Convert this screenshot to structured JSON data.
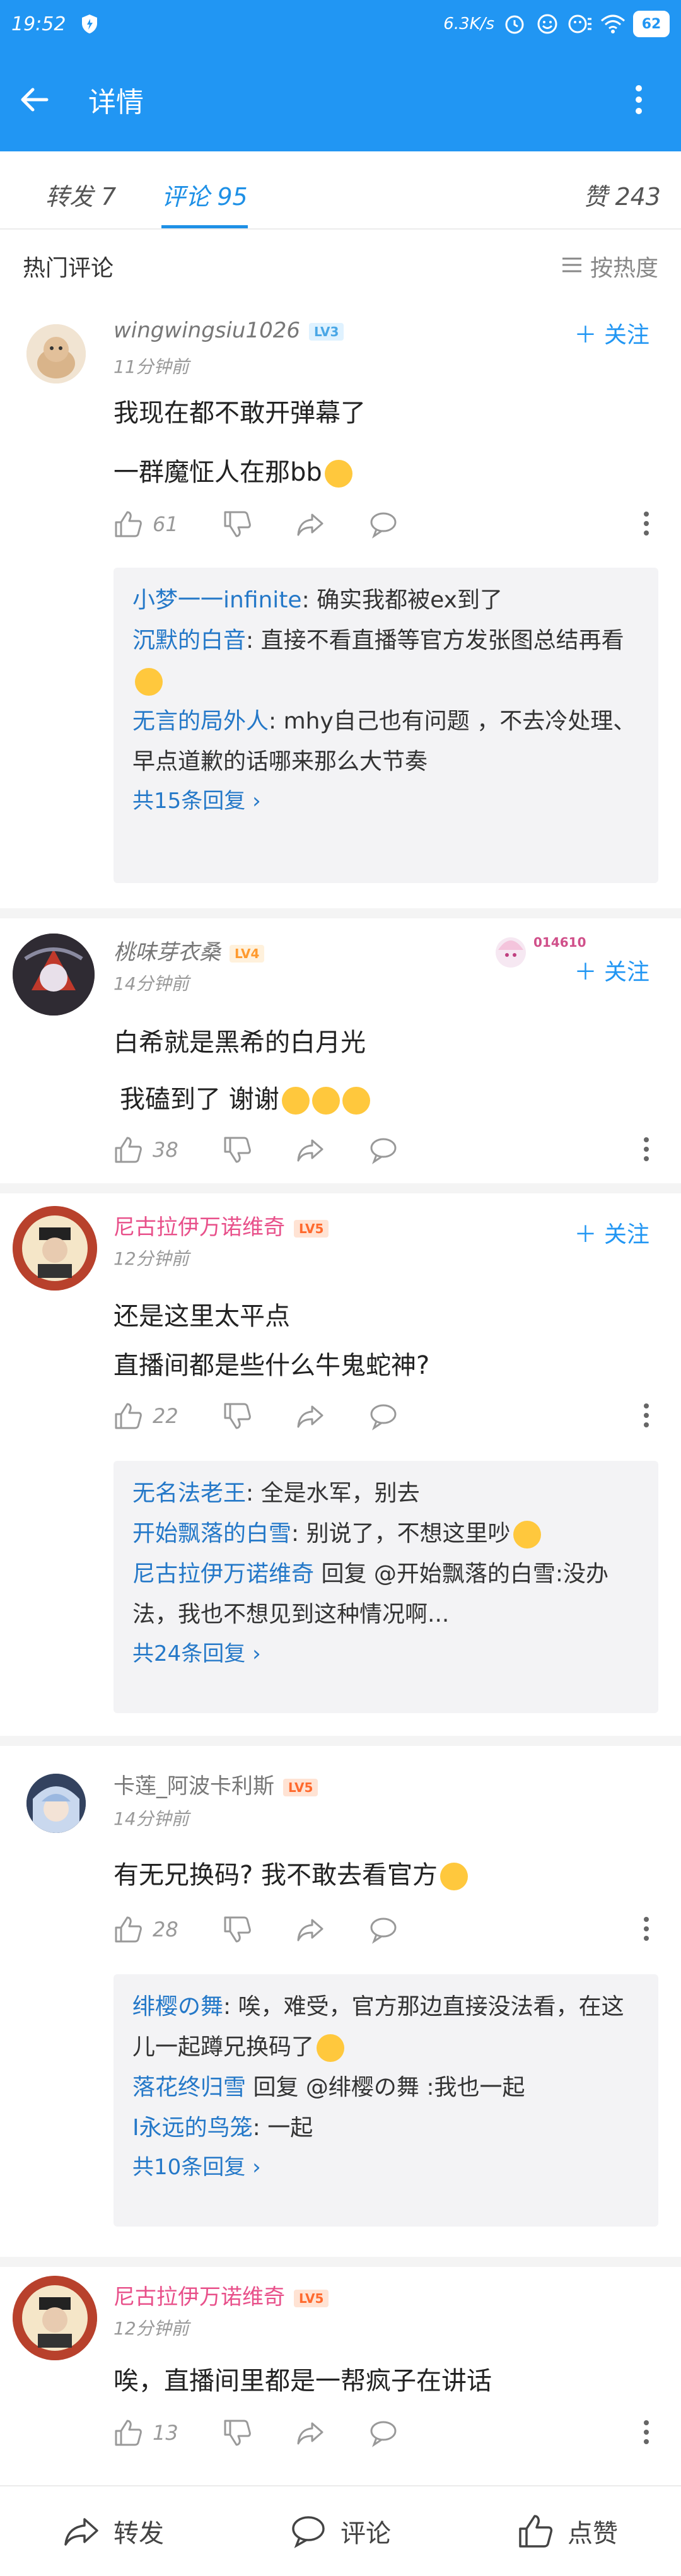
{
  "status_bar": {
    "time": "19:52",
    "network_speed": "6.3K/s",
    "battery": "62"
  },
  "app_bar": {
    "title": "详情"
  },
  "tabs": {
    "repost": "转发 7",
    "comments": "评论 95",
    "likes": "赞 243"
  },
  "section": {
    "hot_label": "热门评论",
    "sort_label": "按热度"
  },
  "comments": [
    {
      "user": "wingwingsiu1026",
      "level": "LV3",
      "time": "11分钟前",
      "lines": [
        "我现在都不敢开弹幕了",
        "一群魔怔人在那bb"
      ],
      "likes": "61",
      "follow": "关注",
      "replies": [
        {
          "name": "小梦一一infinite",
          "text": ": 确实我都被ex到了"
        },
        {
          "name": "沉默的白音",
          "text": ": 直接不看直播等官方发张图总结再看"
        },
        {
          "name": "无言的局外人",
          "text": ": mhy自己也有问题 ，不去冷处理、早点道歉的话哪来那么大节奏"
        }
      ],
      "more_replies": "共15条回复"
    },
    {
      "user": "桃味芽衣桑",
      "level": "LV4",
      "time": "14分钟前",
      "lines": [
        "白希就是黑希的白月光",
        "我磕到了 谢谢"
      ],
      "likes": "38",
      "follow": "关注",
      "badge": "014610"
    },
    {
      "user": "尼古拉伊万诺维奇",
      "level": "LV5",
      "time": "12分钟前",
      "lines": [
        "还是这里太平点",
        "直播间都是些什么牛鬼蛇神?"
      ],
      "likes": "22",
      "follow": "关注",
      "replies": [
        {
          "name": "无名法老王",
          "text": ": 全是水军，别去"
        },
        {
          "name": "开始飘落的白雪",
          "text": ": 别说了，不想这里吵"
        },
        {
          "name": "尼古拉伊万诺维奇",
          "text": " 回复 @开始飘落的白雪:没办法，我也不想见到这种情况啊..."
        }
      ],
      "more_replies": "共24条回复"
    },
    {
      "user": "卡莲_阿波卡利斯",
      "level": "LV5",
      "time": "14分钟前",
      "lines": [
        "有无兄换码? 我不敢去看官方"
      ],
      "likes": "28",
      "replies": [
        {
          "name": "绯樱の舞",
          "text": ": 唉，难受，官方那边直接没法看，在这儿一起蹲兄换码了"
        },
        {
          "name": "落花终归雪",
          "text": " 回复 @绯樱の舞 :我也一起"
        },
        {
          "name": "I永远的鸟笼",
          "text": ": 一起"
        }
      ],
      "more_replies": "共10条回复"
    },
    {
      "user": "尼古拉伊万诺维奇",
      "level": "LV5",
      "time": "12分钟前",
      "lines": [
        "唉，直播间里都是一帮疯子在讲话"
      ],
      "likes": "13"
    }
  ],
  "bottom_bar": {
    "repost": "转发",
    "comment": "评论",
    "like": "点赞"
  },
  "colors": {
    "primary": "#2196f3",
    "link": "#2478c8",
    "vip_name": "#e8508a"
  }
}
